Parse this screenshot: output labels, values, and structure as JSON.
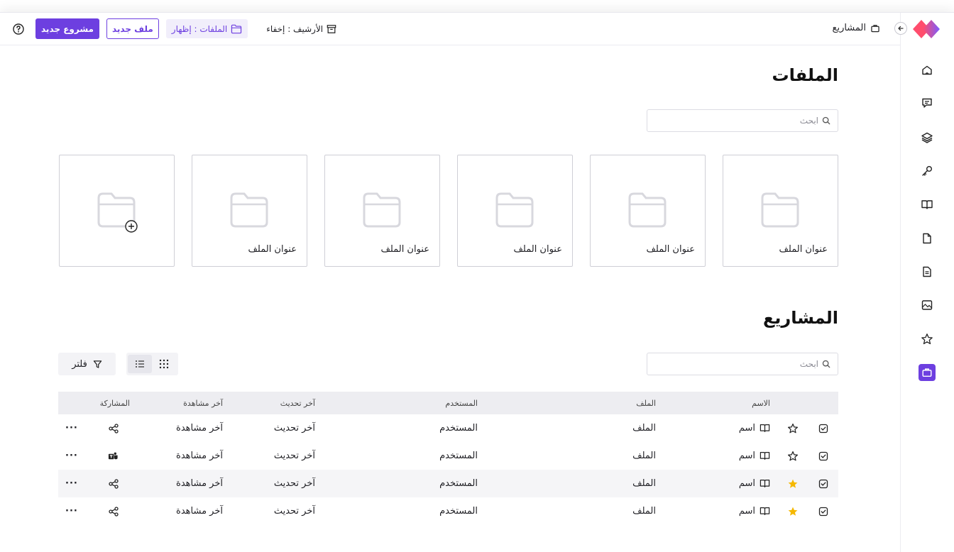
{
  "topbar": {
    "breadcrumb": "المشاريع",
    "archive_toggle": "الأرشيف : إخفاء",
    "files_toggle": "الملفات : إظهار",
    "new_file": "ملف جديد",
    "new_project": "مشروع جديد"
  },
  "sidebar": {
    "items": [
      {
        "icon": "home-icon"
      },
      {
        "icon": "message-icon"
      },
      {
        "icon": "layers-icon"
      },
      {
        "icon": "key-icon"
      },
      {
        "icon": "book-icon"
      },
      {
        "icon": "file-icon"
      },
      {
        "icon": "document-icon"
      },
      {
        "icon": "image-icon"
      },
      {
        "icon": "star-icon"
      },
      {
        "icon": "briefcase-icon",
        "active": true
      }
    ]
  },
  "files": {
    "title": "الملفات",
    "search_placeholder": "ابحث",
    "cards": [
      "عنوان الملف",
      "عنوان الملف",
      "عنوان الملف",
      "عنوان الملف",
      "عنوان الملف"
    ]
  },
  "projects": {
    "title": "المشاريع",
    "search_placeholder": "ابحث",
    "filter_label": "فلتر",
    "columns": {
      "name": "الاسم",
      "file": "الملف",
      "user": "المستخدم",
      "updated": "آخر تحديث",
      "viewed": "آخر مشاهدة",
      "sharing": "المشاركة"
    },
    "rows": [
      {
        "name": "اسم",
        "file": "الملف",
        "user": "المستخدم",
        "updated": "آخر تحديث",
        "viewed": "آخر مشاهدة",
        "starred": false,
        "share_icon": "share-icon"
      },
      {
        "name": "اسم",
        "file": "الملف",
        "user": "المستخدم",
        "updated": "آخر تحديث",
        "viewed": "آخر مشاهدة",
        "starred": false,
        "share_icon": "teams-icon"
      },
      {
        "name": "اسم",
        "file": "الملف",
        "user": "المستخدم",
        "updated": "آخر تحديث",
        "viewed": "آخر مشاهدة",
        "starred": true,
        "share_icon": "share-icon"
      },
      {
        "name": "اسم",
        "file": "الملف",
        "user": "المستخدم",
        "updated": "آخر تحديث",
        "viewed": "آخر مشاهدة",
        "starred": true,
        "share_icon": "share-icon"
      }
    ],
    "more_label": "···"
  },
  "colors": {
    "accent": "#6d3fe0",
    "star": "#f5b800",
    "logo_a": "#7b5cff",
    "logo_b": "#ff4d6d"
  }
}
